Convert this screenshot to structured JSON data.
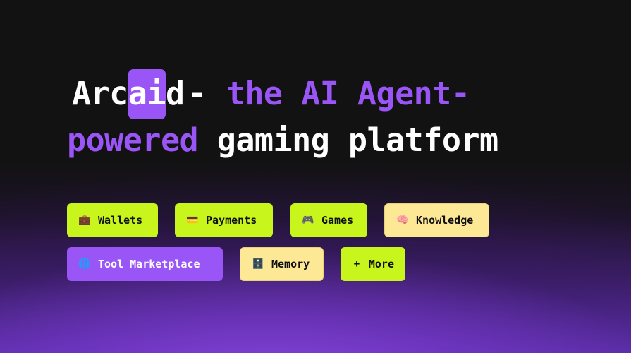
{
  "hero": {
    "brand_prefix": "Arc",
    "brand_highlight": "ai",
    "brand_suffix": "d",
    "separator": "-",
    "tagline_purple_1": "the AI Agent-",
    "tagline_purple_2": "powered",
    "tagline_white": "gaming platform"
  },
  "tags": [
    {
      "icon": "💼",
      "icon_name": "briefcase-icon",
      "label": "Wallets",
      "color": "#c8f51b"
    },
    {
      "icon": "💳",
      "icon_name": "credit-card-icon",
      "label": "Payments",
      "color": "#c8f51b"
    },
    {
      "icon": "🎮",
      "icon_name": "gamepad-icon",
      "label": "Games",
      "color": "#c8f51b"
    },
    {
      "icon": "🧠",
      "icon_name": "brain-icon",
      "label": "Knowledge",
      "color": "#fde895"
    },
    {
      "icon": "🌐",
      "icon_name": "globe-icon",
      "label": "Tool Marketplace",
      "color": "#9a55f6"
    },
    {
      "icon": "🗄️",
      "icon_name": "file-cabinet-icon",
      "label": "Memory",
      "color": "#fde895"
    },
    {
      "icon": "+",
      "icon_name": "plus-icon",
      "label": "More",
      "color": "#c8f51b"
    }
  ],
  "colors": {
    "accent_purple": "#9a55f6",
    "lime": "#c8f51b",
    "cream": "#fde895",
    "background": "#121212"
  }
}
